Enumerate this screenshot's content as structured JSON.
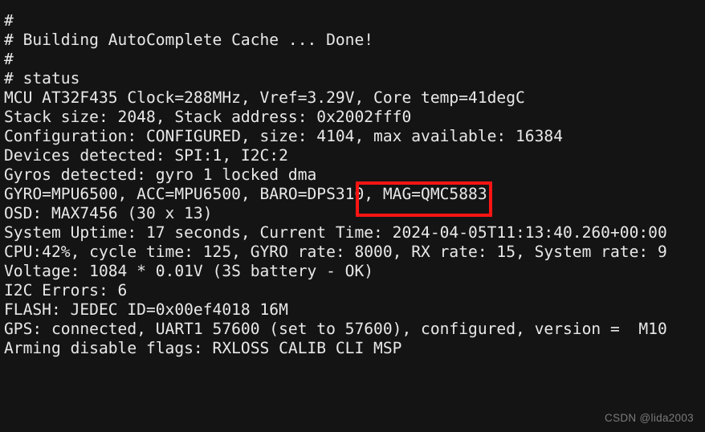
{
  "terminal": {
    "background_color": "#141414",
    "text_color": "#e8e8e8",
    "lines": [
      "#",
      "# Building AutoComplete Cache ... Done!",
      "#",
      "# status",
      "MCU AT32F435 Clock=288MHz, Vref=3.29V, Core temp=41degC",
      "Stack size: 2048, Stack address: 0x2002fff0",
      "Configuration: CONFIGURED, size: 4104, max available: 16384",
      "Devices detected: SPI:1, I2C:2",
      "Gyros detected: gyro 1 locked dma",
      "GYRO=MPU6500, ACC=MPU6500, BARO=DPS310, MAG=QMC5883",
      "OSD: MAX7456 (30 x 13)",
      "System Uptime: 17 seconds, Current Time: 2024-04-05T11:13:40.260+00:00",
      "CPU:42%, cycle time: 125, GYRO rate: 8000, RX rate: 15, System rate: 9",
      "Voltage: 1084 * 0.01V (3S battery - OK)",
      "I2C Errors: 6",
      "FLASH: JEDEC ID=0x00ef4018 16M",
      "GPS: connected, UART1 57600 (set to 57600), configured, version =  M10",
      "Arming disable flags: RXLOSS CALIB CLI MSP"
    ]
  },
  "annotation": {
    "highlight_color": "#ff1414",
    "highlighted_text": ", MAG=QMC5883"
  },
  "watermark": {
    "text": "CSDN @lida2003",
    "color": "#7a7a7a"
  }
}
